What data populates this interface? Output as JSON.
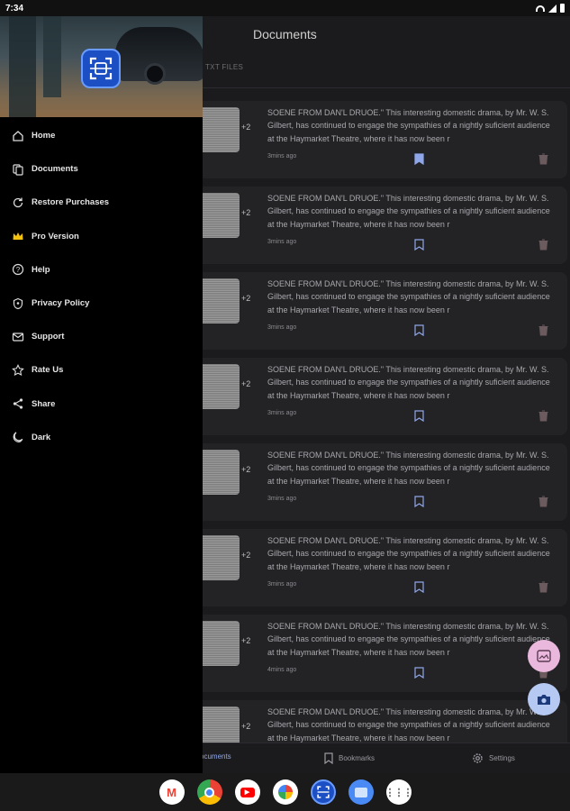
{
  "status_bar": {
    "time": "7:34"
  },
  "app": {
    "title": "Documents",
    "tab_txt": "TXT FILES",
    "documents": [
      {
        "text": "SOENE FROM DAN'L DRUOE.\" This interesting domestic drama, by Mr. W. S. Gilbert, has continued to engage the sympathies of a nightly suficient audience at the Haymarket Theatre, where it has now been r",
        "time": "3mins ago",
        "plus": "+2",
        "bookmarked": true
      },
      {
        "text": "SOENE FROM DAN'L DRUOE.\" This interesting domestic drama, by Mr. W. S. Gilbert, has continued to engage the sympathies of a nightly suficient audience at the Haymarket Theatre, where it has now been r",
        "time": "3mins ago",
        "plus": "+2",
        "bookmarked": false
      },
      {
        "text": "SOENE FROM DAN'L DRUOE.\" This interesting domestic drama, by Mr. W. S. Gilbert, has continued to engage the sympathies of a nightly suficient audience at the Haymarket Theatre, where it has now been r",
        "time": "3mins ago",
        "plus": "+2",
        "bookmarked": false
      },
      {
        "text": "SOENE FROM DAN'L DRUOE.\" This interesting domestic drama, by Mr. W. S. Gilbert, has continued to engage the sympathies of a nightly suficient audience at the Haymarket Theatre, where it has now been r",
        "time": "3mins ago",
        "plus": "+2",
        "bookmarked": false
      },
      {
        "text": "SOENE FROM DAN'L DRUOE.\" This interesting domestic drama, by Mr. W. S. Gilbert, has continued to engage the sympathies of a nightly suficient audience at the Haymarket Theatre, where it has now been r",
        "time": "3mins ago",
        "plus": "+2",
        "bookmarked": false
      },
      {
        "text": "SOENE FROM DAN'L DRUOE.\" This interesting domestic drama, by Mr. W. S. Gilbert, has continued to engage the sympathies of a nightly suficient audience at the Haymarket Theatre, where it has now been r",
        "time": "3mins ago",
        "plus": "+2",
        "bookmarked": false
      },
      {
        "text": "SOENE FROM DAN'L DRUOE.\" This interesting domestic drama, by Mr. W. S. Gilbert, has continued to engage the sympathies of a nightly suficient audience at the Haymarket Theatre, where it has now been r",
        "time": "4mins ago",
        "plus": "+2",
        "bookmarked": false
      },
      {
        "text": "SOENE FROM DAN'L DRUOE.\" This interesting domestic drama, by Mr. W. S. Gilbert, has continued to engage the sympathies of a nightly suficient audience at the Haymarket Theatre, where it has now been r",
        "time": "",
        "plus": "+2",
        "bookmarked": false
      }
    ],
    "bottom_nav": {
      "documents": "ocuments",
      "bookmarks": "Bookmarks",
      "settings": "Settings"
    }
  },
  "drawer": {
    "items": [
      {
        "label": "Home",
        "icon": "home-icon"
      },
      {
        "label": "Documents",
        "icon": "documents-icon"
      },
      {
        "label": "Restore Purchases",
        "icon": "restore-icon"
      },
      {
        "label": "Pro Version",
        "icon": "crown-icon"
      },
      {
        "label": "Help",
        "icon": "help-icon"
      },
      {
        "label": "Privacy Policy",
        "icon": "shield-icon"
      },
      {
        "label": "Support",
        "icon": "mail-icon"
      },
      {
        "label": "Rate Us",
        "icon": "star-icon"
      },
      {
        "label": "Share",
        "icon": "share-icon"
      },
      {
        "label": "Dark",
        "icon": "moon-icon"
      }
    ]
  },
  "dock": {
    "apps": [
      "Gmail",
      "Chrome",
      "YouTube",
      "Photos",
      "Scanner",
      "Files",
      "All apps"
    ]
  },
  "colors": {
    "accent_bookmark": "#8fa6e8",
    "fab_gallery": "#e9b8dc",
    "fab_camera": "#b6c9f3",
    "drawer_bg": "#000000",
    "card_bg": "#232326"
  }
}
